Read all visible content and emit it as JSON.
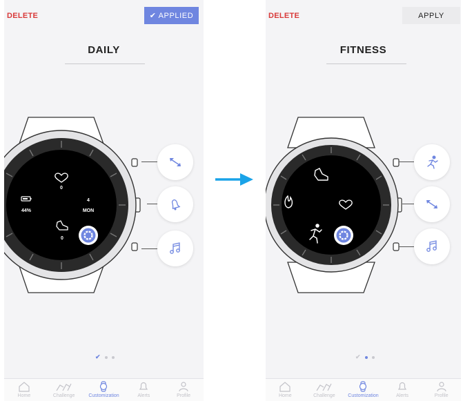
{
  "left": {
    "delete_label": "DELETE",
    "apply_label": "✔ APPLIED",
    "title": "DAILY",
    "face": {
      "heart_value": "0",
      "battery_value": "44%",
      "date_day": "4",
      "date_weekday": "MON",
      "steps_value": "0"
    },
    "buttons": [
      "expand-arrows-icon",
      "alarm-bell-icon",
      "music-note-icon"
    ],
    "pager": {
      "active": 0,
      "count": 3
    }
  },
  "right": {
    "delete_label": "DELETE",
    "apply_label": "APPLY",
    "title": "FITNESS",
    "buttons": [
      "running-person-icon",
      "expand-arrows-icon",
      "music-note-icon"
    ],
    "pager": {
      "active": 1,
      "count": 3
    }
  },
  "tabs": [
    {
      "label": "Home",
      "icon": "home-icon"
    },
    {
      "label": "Challenge",
      "icon": "runners-icon"
    },
    {
      "label": "Customization",
      "icon": "watch-icon",
      "active": true
    },
    {
      "label": "Alerts",
      "icon": "bell-icon"
    },
    {
      "label": "Profile",
      "icon": "person-icon"
    }
  ],
  "colors": {
    "accent": "#6f86e0",
    "delete": "#d93a3a",
    "arrow": "#1aa3e8"
  }
}
